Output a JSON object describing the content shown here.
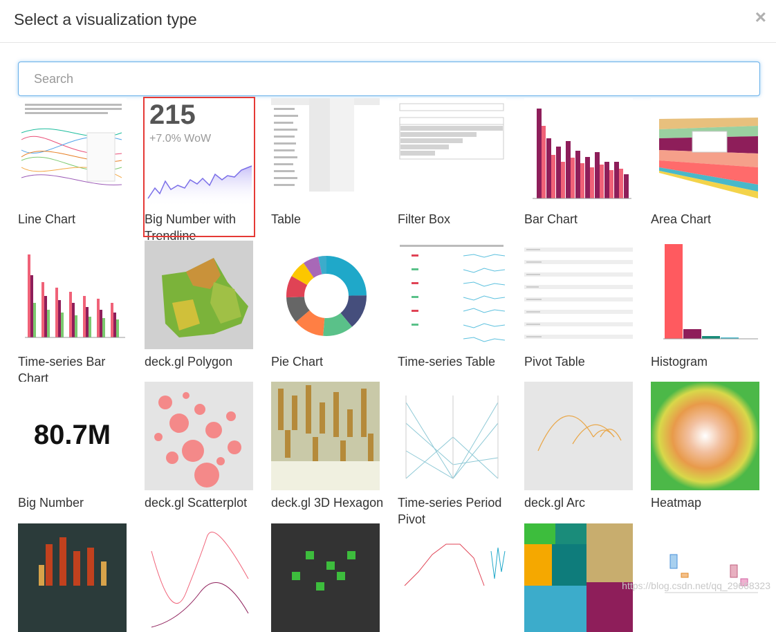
{
  "modal": {
    "title": "Select a visualization type",
    "close_label": "×"
  },
  "search": {
    "placeholder": "Search",
    "value": ""
  },
  "visualizations": [
    {
      "id": "line",
      "label": "Line Chart"
    },
    {
      "id": "bignum-trend",
      "label": "Big Number with Trendline",
      "thumb_value": "215",
      "thumb_sub": "+7.0% WoW",
      "selected": true
    },
    {
      "id": "table",
      "label": "Table"
    },
    {
      "id": "filter",
      "label": "Filter Box"
    },
    {
      "id": "bar",
      "label": "Bar Chart"
    },
    {
      "id": "area",
      "label": "Area Chart"
    },
    {
      "id": "ts-bar",
      "label": "Time-series Bar Chart"
    },
    {
      "id": "deck-polygon",
      "label": "deck.gl Polygon"
    },
    {
      "id": "pie",
      "label": "Pie Chart"
    },
    {
      "id": "ts-table",
      "label": "Time-series Table"
    },
    {
      "id": "pivot",
      "label": "Pivot Table"
    },
    {
      "id": "histogram",
      "label": "Histogram"
    },
    {
      "id": "bignum",
      "label": "Big Number",
      "thumb_value": "80.7M"
    },
    {
      "id": "deck-scatter",
      "label": "deck.gl Scatterplot"
    },
    {
      "id": "deck-hex",
      "label": "deck.gl 3D Hexagon"
    },
    {
      "id": "ts-period",
      "label": "Time-series Period Pivot"
    },
    {
      "id": "deck-arc",
      "label": "deck.gl Arc"
    },
    {
      "id": "heatmap",
      "label": "Heatmap"
    },
    {
      "id": "deck-grid",
      "label": ""
    },
    {
      "id": "line2",
      "label": ""
    },
    {
      "id": "deck-screen",
      "label": ""
    },
    {
      "id": "ts-line",
      "label": ""
    },
    {
      "id": "treemap",
      "label": ""
    },
    {
      "id": "boxplot",
      "label": ""
    }
  ],
  "watermark": "https://blog.csdn.net/qq_29668323",
  "colors": {
    "accent": "#66afe9",
    "selection": "#e53935"
  }
}
